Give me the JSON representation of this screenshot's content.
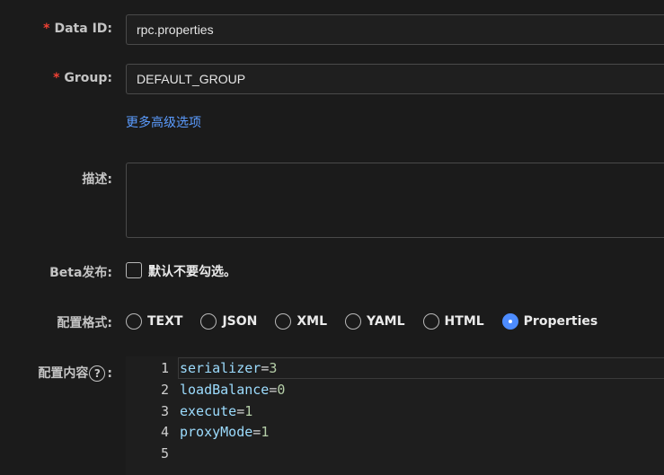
{
  "form": {
    "data_id": {
      "label": "Data ID:",
      "value": "rpc.properties"
    },
    "group": {
      "label": "Group:",
      "value": "DEFAULT_GROUP"
    },
    "advanced_link": "更多高级选项",
    "description": {
      "label": "描述:",
      "value": ""
    },
    "beta": {
      "label": "Beta发布:",
      "checkbox_text": "默认不要勾选。",
      "checked": false
    },
    "format": {
      "label": "配置格式:",
      "options": [
        "TEXT",
        "JSON",
        "XML",
        "YAML",
        "HTML",
        "Properties"
      ],
      "selected": "Properties"
    },
    "content": {
      "label": "配置内容",
      "help_glyph": "?",
      "label_colon": ":",
      "lines": [
        {
          "num": "1",
          "key": "serializer",
          "eq": "=",
          "val": "3"
        },
        {
          "num": "2",
          "key": "loadBalance",
          "eq": "=",
          "val": "0"
        },
        {
          "num": "3",
          "key": "execute",
          "eq": "=",
          "val": "1"
        },
        {
          "num": "4",
          "key": "proxyMode",
          "eq": "=",
          "val": "1"
        },
        {
          "num": "5",
          "key": "",
          "eq": "",
          "val": ""
        }
      ]
    },
    "required_mark": "*"
  },
  "colors": {
    "accent": "#4d8cff",
    "link": "#5b9cff",
    "required": "#f04134",
    "background": "#1b1b1b"
  }
}
